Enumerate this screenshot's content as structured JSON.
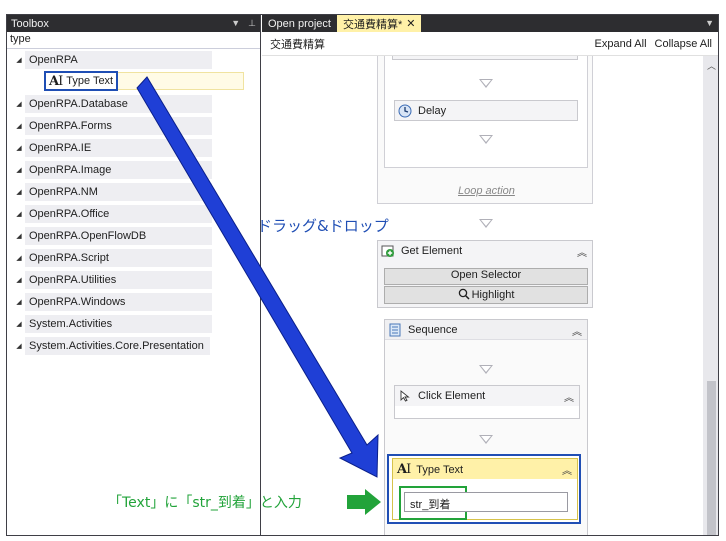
{
  "toolbox": {
    "title": "Toolbox",
    "search_value": "type",
    "categories": [
      {
        "label": "OpenRPA"
      },
      {
        "label": "OpenRPA.Database"
      },
      {
        "label": "OpenRPA.Forms"
      },
      {
        "label": "OpenRPA.IE"
      },
      {
        "label": "OpenRPA.Image"
      },
      {
        "label": "OpenRPA.NM"
      },
      {
        "label": "OpenRPA.Office"
      },
      {
        "label": "OpenRPA.OpenFlowDB"
      },
      {
        "label": "OpenRPA.Script"
      },
      {
        "label": "OpenRPA.Utilities"
      },
      {
        "label": "OpenRPA.Windows"
      },
      {
        "label": "System.Activities"
      },
      {
        "label": "System.Activities.Core.Presentation"
      }
    ],
    "item": {
      "icon": "type-text-icon",
      "glyph": "A",
      "label": "Type Text"
    }
  },
  "designer": {
    "tabs": [
      {
        "label": "Open project"
      },
      {
        "label": "交通費精算*"
      }
    ],
    "breadcrumb": "交通費精算",
    "expand_all": "Expand All",
    "collapse_all": "Collapse All",
    "delay_label": "Delay",
    "loop_action": "Loop action",
    "get_element": "Get Element",
    "open_selector": "Open Selector",
    "highlight": "Highlight",
    "sequence": "Sequence",
    "click_element": "Click Element",
    "type_text": "Type Text",
    "text_value": "str_到着"
  },
  "annotations": {
    "drag_drop": "ドラッグ&ドロップ",
    "input_note": "「Text」に「str_到着」と入力"
  },
  "colors": {
    "annotation_blue": "#1f4eb4",
    "annotation_green": "#22a33a",
    "active_tab": "#fff1a8",
    "titlebar": "#2d2d30"
  }
}
